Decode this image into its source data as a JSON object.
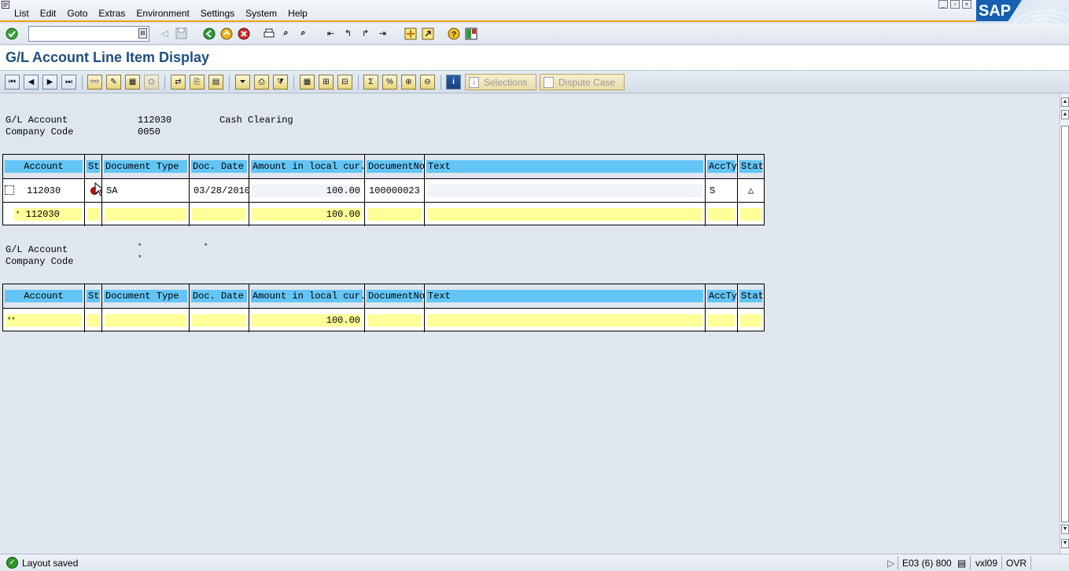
{
  "menu": [
    "List",
    "Edit",
    "Goto",
    "Extras",
    "Environment",
    "Settings",
    "System",
    "Help"
  ],
  "std_toolbar": {
    "command_value": "",
    "icons": [
      "enter-icon",
      "back-icon",
      "save-icon",
      "back-green-icon",
      "exit-icon",
      "cancel-icon",
      "print-icon",
      "find-icon",
      "find-next-icon",
      "first-page-icon",
      "prev-page-icon",
      "next-page-icon",
      "last-page-icon",
      "create-session-icon",
      "shortcut-icon",
      "help-icon",
      "layout-icon"
    ]
  },
  "title": "G/L Account Line Item Display",
  "app_toolbar": {
    "selections_label": "Selections",
    "dispute_label": "Dispute Case"
  },
  "section1": {
    "gl_label": "G/L Account",
    "gl_value": "112030",
    "gl_name": "Cash Clearing",
    "cc_label": "Company Code",
    "cc_value": "0050"
  },
  "columns": [
    "Account",
    "St",
    "Document Type",
    "Doc. Date",
    "Amount in local cur.",
    "DocumentNo",
    "Text",
    "AccTy",
    "Stat"
  ],
  "table1": {
    "rows": [
      {
        "account": "112030",
        "doc_type": "SA",
        "doc_date": "03/28/2010",
        "amount": "100.00",
        "doc_no": "100000023",
        "text": "",
        "acc_ty": "S",
        "stat": "△"
      }
    ],
    "subtotal": {
      "marker": "*",
      "account": "112030",
      "amount": "100.00"
    }
  },
  "section2": {
    "gl_label": "G/L Account",
    "gl_value": "*",
    "gl_name": "*",
    "cc_label": "Company Code",
    "cc_value": "*"
  },
  "table2": {
    "total": {
      "marker": "**",
      "amount": "100.00"
    }
  },
  "status": {
    "message": "Layout saved",
    "system": "E03 (6) 800",
    "server": "vxl09",
    "mode": "OVR"
  }
}
